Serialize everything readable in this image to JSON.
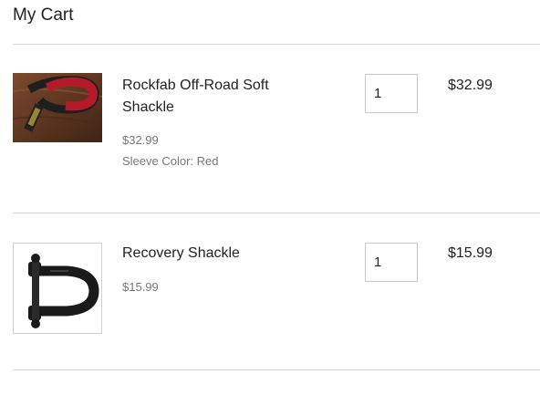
{
  "cart": {
    "title": "My Cart"
  },
  "items": [
    {
      "image": "red-soft-shackle-photo",
      "name": "Rockfab Off-Road Soft Shackle",
      "unit_price": "$32.99",
      "option": "Sleeve Color: Red",
      "quantity": "1",
      "line_total": "$32.99"
    },
    {
      "image": "black-d-ring-shackle-icon",
      "name": "Recovery Shackle",
      "unit_price": "$15.99",
      "quantity": "1",
      "line_total": "$15.99"
    }
  ]
}
